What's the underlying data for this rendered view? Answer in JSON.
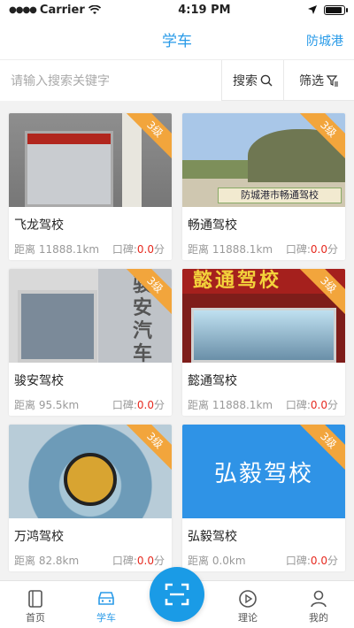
{
  "status_bar": {
    "carrier": "Carrier",
    "time": "4:19 PM"
  },
  "nav": {
    "title": "学车",
    "city": "防城港"
  },
  "search": {
    "placeholder": "请输入搜索关键字",
    "search_label": "搜索",
    "filter_label": "筛选"
  },
  "schools": [
    {
      "name": "飞龙驾校",
      "grade": "3级",
      "distance": "距离 11888.1km",
      "rating_label": "口碑:",
      "rating_value": "0.0",
      "rating_unit": "分"
    },
    {
      "name": "畅通驾校",
      "grade": "3级",
      "distance": "距离 11888.1km",
      "rating_label": "口碑:",
      "rating_value": "0.0",
      "rating_unit": "分",
      "image_text": "防城港市畅通驾校"
    },
    {
      "name": "骏安驾校",
      "grade": "3级",
      "distance": "距离 95.5km",
      "rating_label": "口碑:",
      "rating_value": "0.0",
      "rating_unit": "分",
      "image_text": "骏安汽车驾驶"
    },
    {
      "name": "懿通驾校",
      "grade": "3级",
      "distance": "距离 11888.1km",
      "rating_label": "口碑:",
      "rating_value": "0.0",
      "rating_unit": "分",
      "image_text": "懿通驾校"
    },
    {
      "name": "万鸿驾校",
      "grade": "3级",
      "distance": "距离 82.8km",
      "rating_label": "口碑:",
      "rating_value": "0.0",
      "rating_unit": "分"
    },
    {
      "name": "弘毅驾校",
      "grade": "3级",
      "distance": "距离 0.0km",
      "rating_label": "口碑:",
      "rating_value": "0.0",
      "rating_unit": "分",
      "image_text": "弘毅驾校"
    }
  ],
  "tabs": [
    {
      "label": "首页",
      "icon": "book-icon"
    },
    {
      "label": "学车",
      "icon": "car-icon",
      "active": true
    },
    {
      "label": "",
      "icon": "scan-icon"
    },
    {
      "label": "理论",
      "icon": "play-icon"
    },
    {
      "label": "我的",
      "icon": "person-icon"
    }
  ],
  "colors": {
    "accent": "#2a9be8",
    "badge": "#f2a53c",
    "score": "#e6291f"
  }
}
